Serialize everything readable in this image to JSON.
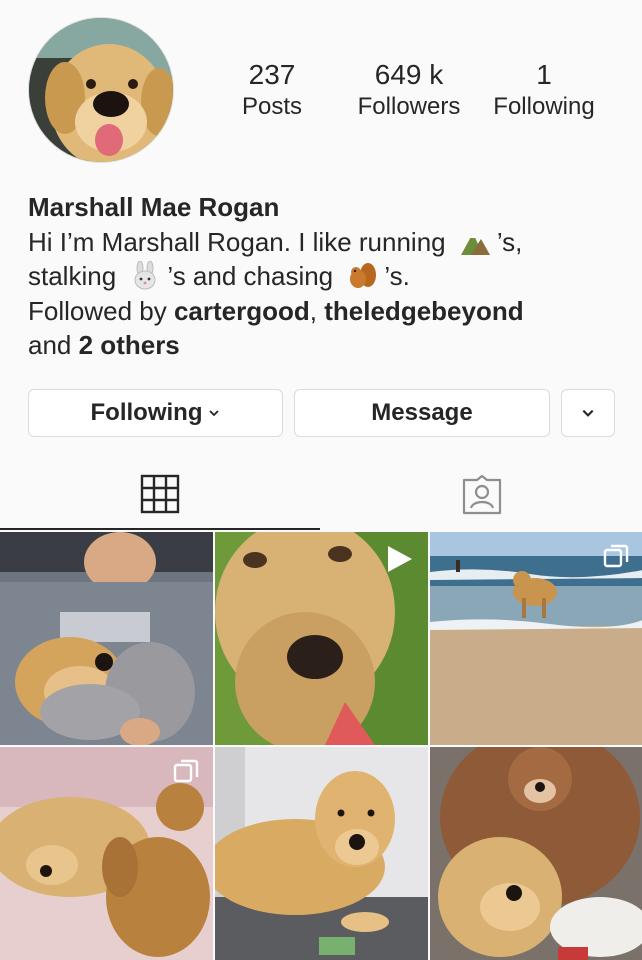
{
  "profile": {
    "avatar_icon": "dog-avatar",
    "stats": {
      "posts_count": "237",
      "posts_label": "Posts",
      "followers_count": "649 k",
      "followers_label": "Followers",
      "following_count": "1",
      "following_label": "Following"
    },
    "name": "Marshall Mae Rogan",
    "bio": {
      "part1": "Hi I’m Marshall Rogan. I like running",
      "part2": "’s,",
      "part3": "stalking",
      "part4": "’s and chasing",
      "part5": "’s.",
      "emoji1": "mountain-emoji",
      "emoji2": "rabbit-emoji",
      "emoji3": "squirrel-emoji"
    },
    "followed_by": {
      "prefix": "Followed by",
      "user1": "cartergood",
      "sep": ",",
      "user2": "theledgebeyond",
      "and": "and",
      "others": "2 others"
    }
  },
  "actions": {
    "following_label": "Following",
    "message_label": "Message"
  },
  "tabs": [
    {
      "icon": "grid-icon",
      "active": true
    },
    {
      "icon": "tagged-icon",
      "active": false
    }
  ],
  "posts": [
    {
      "subject": "man-hugging-dog",
      "badge": ""
    },
    {
      "subject": "dog-closeup",
      "badge": "video-icon"
    },
    {
      "subject": "dog-at-beach",
      "badge": "multi-photo-icon"
    },
    {
      "subject": "dog-sleeping-with-bear",
      "badge": "multi-photo-icon"
    },
    {
      "subject": "dog-lying-on-rug",
      "badge": ""
    },
    {
      "subject": "dog-with-teddy-bear",
      "badge": ""
    }
  ]
}
